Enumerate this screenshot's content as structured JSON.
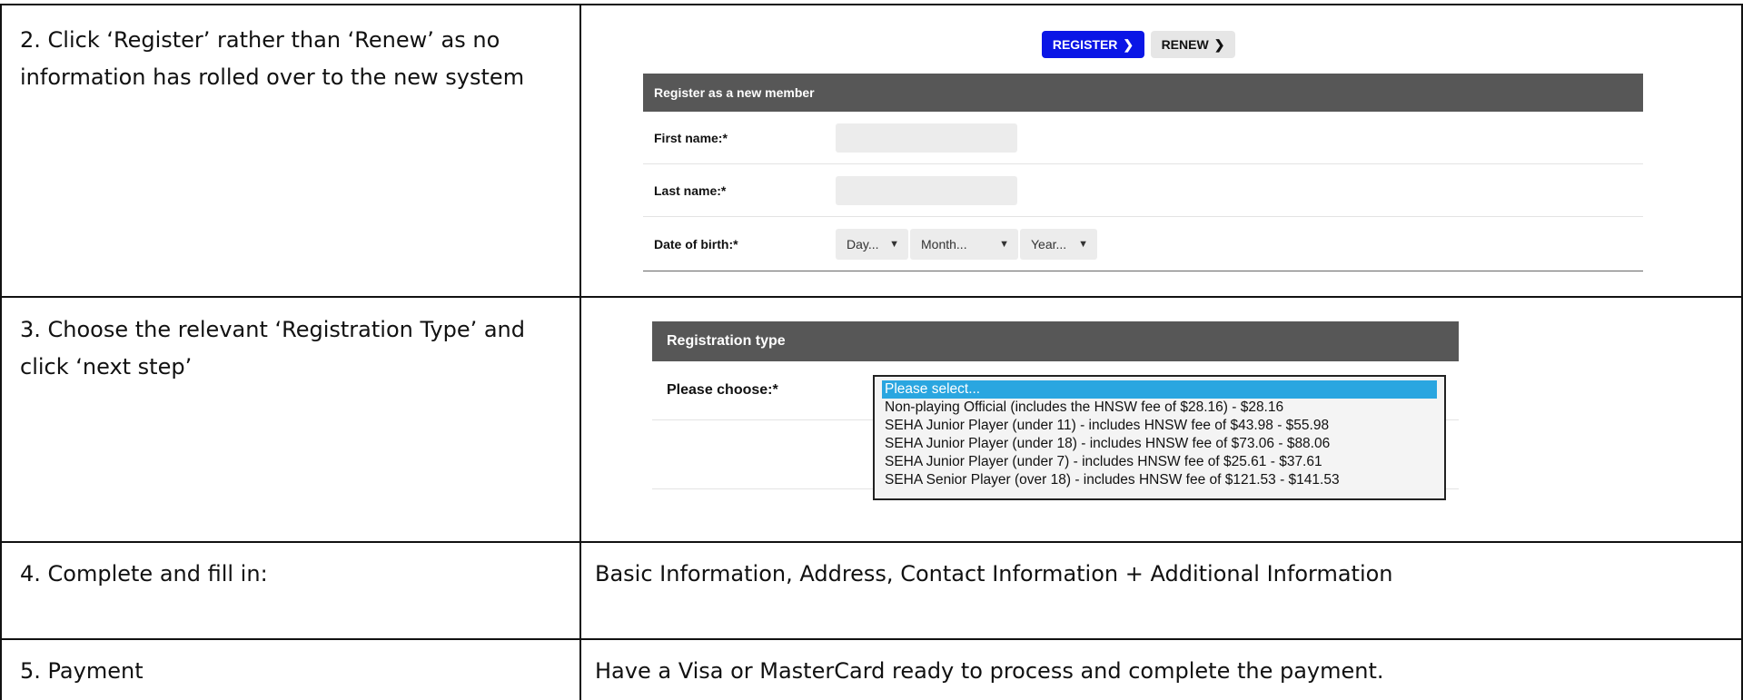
{
  "rows": [
    {
      "step": [
        "2. Click ‘Register’ rather than ‘Renew’ as no",
        "information has rolled over to the new system"
      ]
    },
    {
      "step": [
        "3. Choose the relevant ‘Registration Type’ and",
        "click ‘next step’"
      ]
    },
    {
      "step": [
        "4. Complete and fill in:"
      ],
      "detail": "Basic Information, Address, Contact Information + Additional Information"
    },
    {
      "step": [
        "5. Payment"
      ],
      "detail": "Have a Visa or MasterCard ready to process and complete the payment."
    }
  ],
  "register_form": {
    "register_button": "REGISTER",
    "renew_button": "RENEW",
    "header": "Register as a new member",
    "first_name_label": "First name:*",
    "last_name_label": "Last name:*",
    "dob_label": "Date of birth:*",
    "dob_day": "Day...",
    "dob_month": "Month...",
    "dob_year": "Year...",
    "caret": "▼",
    "chevron": "❯"
  },
  "registration_type": {
    "header": "Registration type",
    "label": "Please choose:*",
    "options": [
      "Please select...",
      "Non-playing Official (includes the HNSW fee of $28.16) - $28.16",
      "SEHA Junior Player (under 11) - includes HNSW fee of $43.98 - $55.98",
      "SEHA Junior Player (under 18) - includes HNSW fee of $73.06 - $88.06",
      "SEHA Junior Player (under 7) - includes HNSW fee of $25.61 - $37.61",
      "SEHA Senior Player (over 18) - includes HNSW fee of $121.53 - $141.53"
    ],
    "selected_index": 0
  },
  "colors": {
    "register_button": "#0a16e6",
    "panel_header": "#575757",
    "selected_option": "#2aa6e0"
  }
}
